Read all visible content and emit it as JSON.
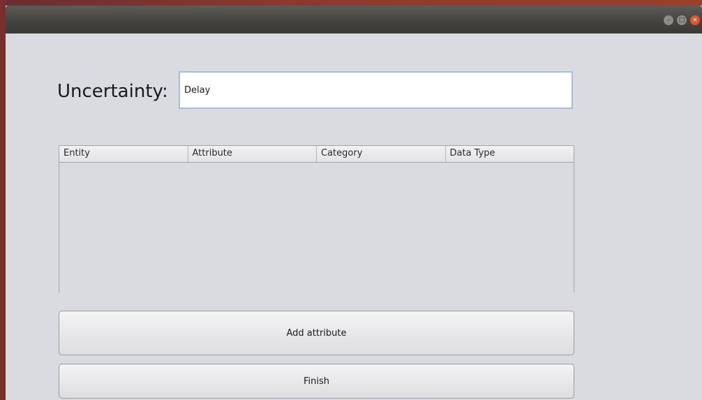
{
  "window": {
    "controls": {
      "minimize_icon": "–",
      "maximize_icon": "□",
      "close_icon": "×"
    }
  },
  "form": {
    "uncertainty_label": "Uncertainty:",
    "uncertainty_value": "Delay"
  },
  "table": {
    "columns": [
      "Entity",
      "Attribute",
      "Category",
      "Data Type"
    ],
    "rows": []
  },
  "buttons": {
    "add_attribute": "Add attribute",
    "finish": "Finish"
  },
  "colors": {
    "titlebar": "#45443f",
    "window_bg": "#d9dbe1",
    "input_border": "#a6bfd9",
    "close_button": "#e0542c"
  }
}
